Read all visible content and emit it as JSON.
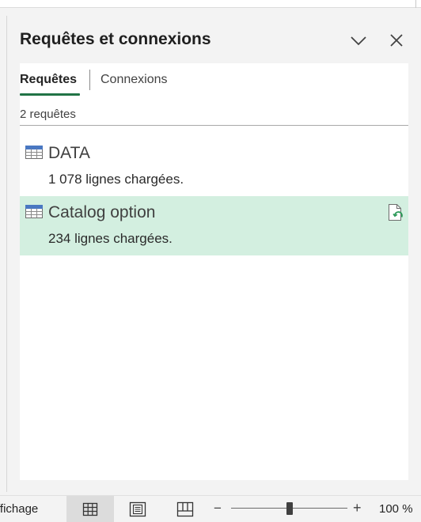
{
  "pane": {
    "title": "Requêtes et connexions"
  },
  "tabs": [
    {
      "label": "Requêtes",
      "active": true
    },
    {
      "label": "Connexions",
      "active": false
    }
  ],
  "queries_count": "2 requêtes",
  "queries": [
    {
      "name": "DATA",
      "status": "1 078 lignes chargées.",
      "selected": false
    },
    {
      "name": "Catalog option",
      "status": "234 lignes chargées.",
      "selected": true
    }
  ],
  "statusbar": {
    "left_text": "ffichage",
    "zoom_minus": "−",
    "zoom_plus": "+",
    "zoom": "100 %"
  },
  "colors": {
    "accent": "#217346",
    "selected_row": "#d3efe0",
    "table_icon": "#4a78c2"
  },
  "icons": {
    "collapse": "chevron-down-icon",
    "close": "close-icon",
    "query": "table-icon",
    "refresh": "refresh-document-icon",
    "view_normal": "grid-view-icon",
    "view_layout": "page-layout-icon",
    "view_break": "page-break-icon"
  }
}
